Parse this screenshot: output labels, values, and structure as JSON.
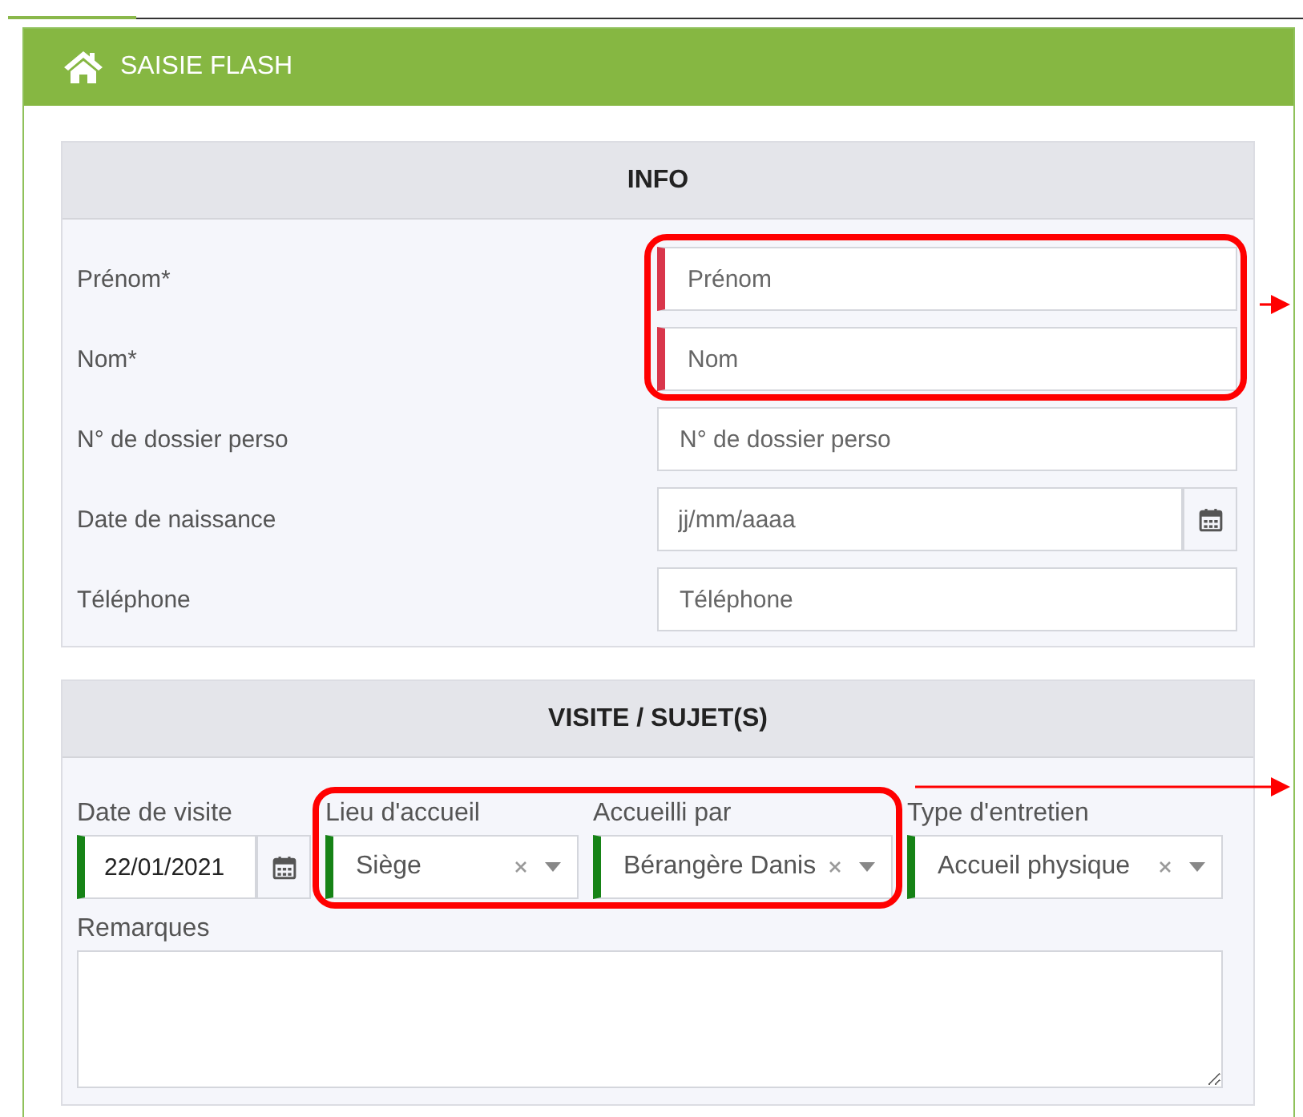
{
  "panel": {
    "title": "SAISIE FLASH"
  },
  "sections": [
    {
      "title": "INFO",
      "kind": "rows",
      "fields": [
        {
          "kind": "text",
          "label": "Prénom*",
          "placeholder": "Prénom",
          "valid": false,
          "highlighted": true
        },
        {
          "kind": "text",
          "label": "Nom*",
          "placeholder": "Nom",
          "valid": false,
          "highlighted": true
        },
        {
          "kind": "text",
          "label": "N° de dossier perso",
          "placeholder": "N° de dossier perso",
          "highlighted": false
        },
        {
          "kind": "date",
          "label": "Date de naissance",
          "placeholder": "jj/mm/aaaa",
          "highlighted": false
        },
        {
          "kind": "text",
          "label": "Téléphone",
          "placeholder": "Téléphone",
          "highlighted": false
        }
      ]
    },
    {
      "title": "VISITE / SUJET(S)",
      "kind": "columns",
      "fields": [
        {
          "kind": "date",
          "label": "Date de visite",
          "value": "22/01/2021",
          "valid": true,
          "highlighted": false
        },
        {
          "kind": "select",
          "label": "Lieu d'accueil",
          "value": "Siège",
          "valid": true,
          "highlighted": true
        },
        {
          "kind": "select",
          "label": "Accueilli par",
          "value": "Bérangère Danis",
          "valid": true,
          "highlighted": true
        },
        {
          "kind": "select",
          "label": "Type d'entretien",
          "value": "Accueil physique",
          "valid": true,
          "highlighted": false
        },
        {
          "kind": "textarea",
          "label": "Remarques",
          "highlighted": false
        }
      ]
    }
  ]
}
